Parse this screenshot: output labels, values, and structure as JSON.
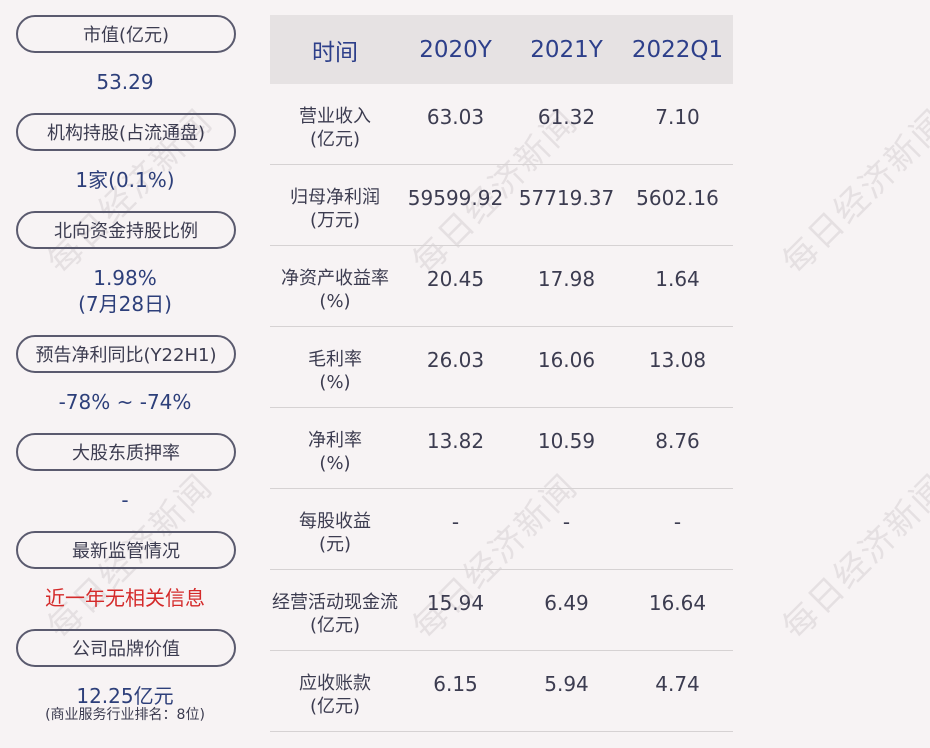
{
  "left": {
    "items": [
      {
        "label": "市值(亿元)",
        "value": "53.29"
      },
      {
        "label": "机构持股(占流通盘)",
        "value": "1家(0.1%)"
      },
      {
        "label": "北向资金持股比例",
        "value": "1.98%",
        "value2": "(7月28日)"
      },
      {
        "label": "预告净利同比(Y22H1)",
        "value": "-78% ~ -74%"
      },
      {
        "label": "大股东质押率",
        "value": "-"
      },
      {
        "label": "最新监管情况",
        "value": "近一年无相关信息"
      },
      {
        "label": "公司品牌价值",
        "value": "12.25亿元",
        "value2": "(商业服务行业排名：8位)"
      }
    ]
  },
  "table": {
    "headers": [
      "时间",
      "2020Y",
      "2021Y",
      "2022Q1"
    ],
    "rows": [
      {
        "label1": "营业收入",
        "label2": "(亿元)",
        "v": [
          "63.03",
          "61.32",
          "7.10"
        ]
      },
      {
        "label1": "归母净利润",
        "label2": "(万元)",
        "v": [
          "59599.92",
          "57719.37",
          "5602.16"
        ]
      },
      {
        "label1": "净资产收益率",
        "label2": "(%)",
        "v": [
          "20.45",
          "17.98",
          "1.64"
        ]
      },
      {
        "label1": "毛利率",
        "label2": "(%)",
        "v": [
          "26.03",
          "16.06",
          "13.08"
        ]
      },
      {
        "label1": "净利率",
        "label2": "(%)",
        "v": [
          "13.82",
          "10.59",
          "8.76"
        ]
      },
      {
        "label1": "每股收益",
        "label2": "(元)",
        "v": [
          "-",
          "-",
          "-"
        ]
      },
      {
        "label1": "经营活动现金流",
        "label2": "(亿元)",
        "v": [
          "15.94",
          "6.49",
          "16.64"
        ]
      },
      {
        "label1": "应收账款",
        "label2": "(亿元)",
        "v": [
          "6.15",
          "5.94",
          "4.74"
        ]
      }
    ]
  },
  "watermark": "每日经济新闻",
  "colors": {
    "background": "#f7f3f4",
    "header_bg": "#e6e2e3",
    "value_blue": "#2d3f7a",
    "alert_red": "#d42a2a"
  }
}
